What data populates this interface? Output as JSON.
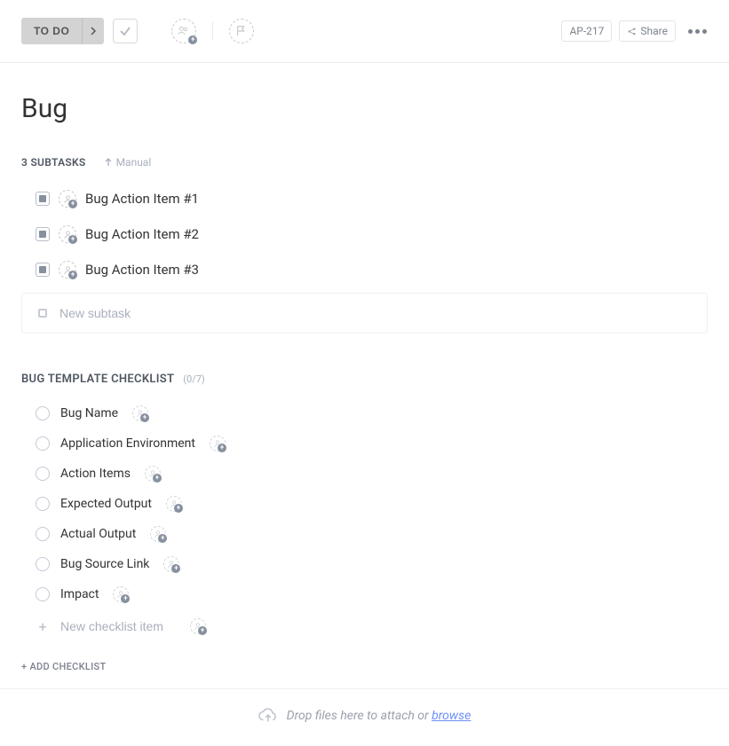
{
  "toolbar": {
    "status_label": "TO DO",
    "task_id": "AP-217",
    "share_label": "Share"
  },
  "task": {
    "title": "Bug"
  },
  "subtasks": {
    "count_label": "3 SUBTASKS",
    "sort_label": "Manual",
    "items": [
      {
        "title": "Bug Action Item #1"
      },
      {
        "title": "Bug Action Item #2"
      },
      {
        "title": "Bug Action Item #3"
      }
    ],
    "new_placeholder": "New subtask"
  },
  "checklist": {
    "title": "BUG TEMPLATE CHECKLIST",
    "count_label": "(0/7)",
    "items": [
      {
        "label": "Bug Name"
      },
      {
        "label": "Application Environment"
      },
      {
        "label": "Action Items"
      },
      {
        "label": "Expected Output"
      },
      {
        "label": "Actual Output"
      },
      {
        "label": "Bug Source Link"
      },
      {
        "label": "Impact"
      }
    ],
    "new_placeholder": "New checklist item",
    "add_label": "+ ADD CHECKLIST"
  },
  "dropzone": {
    "text": "Drop files here to attach or ",
    "link": "browse"
  }
}
